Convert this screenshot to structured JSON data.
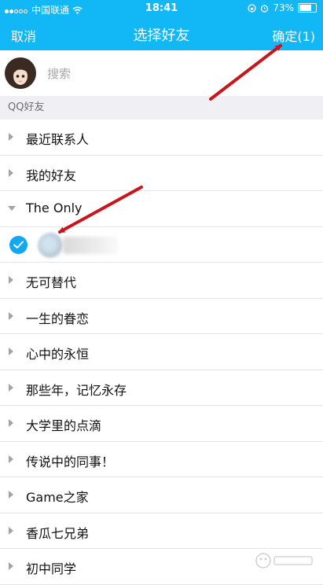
{
  "status_bar": {
    "carrier": "中国联通",
    "time": "18:41",
    "battery": "73%",
    "battery_level": 0.73
  },
  "nav": {
    "cancel": "取消",
    "title": "选择好友",
    "confirm": "确定(1)"
  },
  "search": {
    "placeholder": "搜索"
  },
  "section": {
    "title": "QQ好友"
  },
  "groups": [
    {
      "label": "最近联系人",
      "expanded": false
    },
    {
      "label": "我的好友",
      "expanded": false
    },
    {
      "label": "The Only",
      "expanded": true
    },
    {
      "label": "无可替代",
      "expanded": false
    },
    {
      "label": "一生的眷恋",
      "expanded": false
    },
    {
      "label": "心中的永恒",
      "expanded": false
    },
    {
      "label": "那些年，记忆永存",
      "expanded": false
    },
    {
      "label": "大学里的点滴",
      "expanded": false
    },
    {
      "label": "传说中的同事！",
      "expanded": false
    },
    {
      "label": "Game之家",
      "expanded": false
    },
    {
      "label": "香瓜七兄弟",
      "expanded": false
    },
    {
      "label": "初中同学",
      "expanded": false
    }
  ],
  "colors": {
    "accent": "#12b7f5",
    "check": "#12a8ef",
    "annotation_arrow": "#c8161d"
  }
}
